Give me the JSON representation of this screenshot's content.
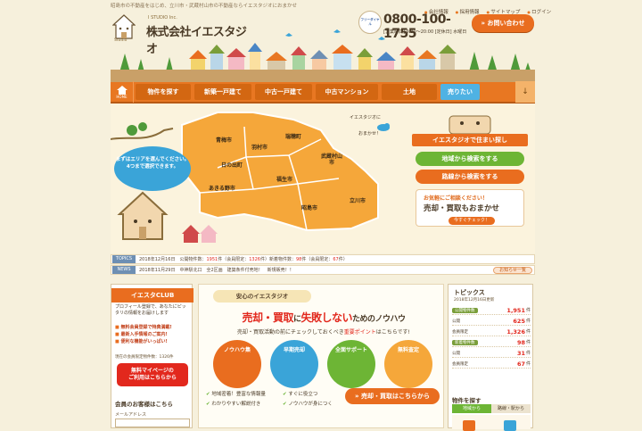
{
  "header": {
    "top_note": "昭島市の不動産をはじめ、立川市・武蔵村山市の不動産ならイエスタジオにおまかせ",
    "logo_sub": "I STUDIO Inc.",
    "logo_text": "株式会社イエスタジオ",
    "logo_small": "Studio",
    "links": [
      "会社情報",
      "採用情報",
      "サイトマップ",
      "ログイン"
    ],
    "tel_icon": "フリーダイヤル",
    "tel": "0800-100-1755",
    "hours": "[営業時間] 9:30〜20:00 [定休日] 水曜日",
    "contact_button": "» お問い合わせ"
  },
  "nav": {
    "home_label": "HOME",
    "items": [
      "物件を探す",
      "新築一戸建て",
      "中古一戸建て",
      "中古マンション",
      "土地",
      "売りたい"
    ],
    "arrow": "↓"
  },
  "map": {
    "bubble": "まずはエリアを選んでください。4つまで選択できます。",
    "tag_top": "イエスタジオに",
    "tag_bottom": "おまかせ！",
    "areas": [
      "青梅市",
      "羽村市",
      "瑞穂町",
      "日の出町",
      "武蔵村山市",
      "あきる野市",
      "福生市",
      "立川市",
      "昭島市"
    ]
  },
  "board": {
    "title": "イエスタジオで住まい探し",
    "area_search": "地域から検索をする",
    "line_search": "路線から検索をする",
    "consult_line1": "お気軽にご相談ください！",
    "consult_line2": "売却・買取もおまかせ",
    "consult_button": "今すぐチェック！"
  },
  "topics": {
    "tag": "TOPICS",
    "text1": "2018年12月16日　公開物件数：",
    "count1": "1951",
    "text2": "件（会員限定：",
    "count2": "1326",
    "text3": "件）新着物件数：",
    "count3": "98",
    "text4": "件（会員限定：",
    "count4": "67",
    "text5": "件）"
  },
  "news": {
    "tag": "NEWS",
    "text": "2018年11月29日　中神駅北口　全2区画　建築条件付売地！　新規販売！！",
    "button": "お知らせ一覧"
  },
  "club": {
    "title": "イエスタCLUB",
    "desc": "プロフィール登録で、あなたにピッタリの情報をお届けします",
    "list": [
      "無料会員登録で特典満載!",
      "最新入手情報のご案内!",
      "便利な機能がいっぱい!"
    ],
    "count_label": "現在の会員限定物件数：1326件",
    "register_button_1": "無料マイページの",
    "register_button_2": "ご利用はこちらから",
    "login_title": "会員のお客様はこちら",
    "login_label": "メールアドレス"
  },
  "center": {
    "header": "安心のイエスタジオ",
    "heading_1": "売却・買取",
    "heading_2": "に",
    "heading_3": "失敗しない",
    "heading_4": "ためのノウハウ",
    "sub_1": "売却・買取活動の前にチェックしておくべき",
    "sub_2": "重要ポイント",
    "sub_3": "はこちらです!",
    "circles": [
      "ノウハウ集",
      "早期売却",
      "全面サポート",
      "無料査定"
    ],
    "checks": [
      "地域密着！豊富な情報量",
      "すぐに役立つ",
      "わかりやすい解説付き",
      "ノウハウが身につく"
    ],
    "sell_button": "» 売却・買取はこちらから"
  },
  "right": {
    "title": "トピックス",
    "date": "2018年12月16日更新",
    "stats": [
      {
        "label": "公開物件数",
        "value": "1,951",
        "plain": false
      },
      {
        "label": "公開",
        "value": "625",
        "plain": true
      },
      {
        "label": "会員限定",
        "value": "1,326",
        "plain": true
      },
      {
        "label": "新着物件数",
        "value": "98",
        "plain": false
      },
      {
        "label": "公開",
        "value": "31",
        "plain": true
      },
      {
        "label": "会員限定",
        "value": "67",
        "plain": true
      }
    ],
    "unit": "件",
    "search_title": "物件を探す",
    "tab_area": "地域から",
    "tab_line": "路線・駅から"
  },
  "colors": {
    "orange": "#e87722",
    "blue": "#3aa4d8",
    "green": "#6db535",
    "map_fill": "#f5a73a",
    "red": "#e2281d"
  }
}
